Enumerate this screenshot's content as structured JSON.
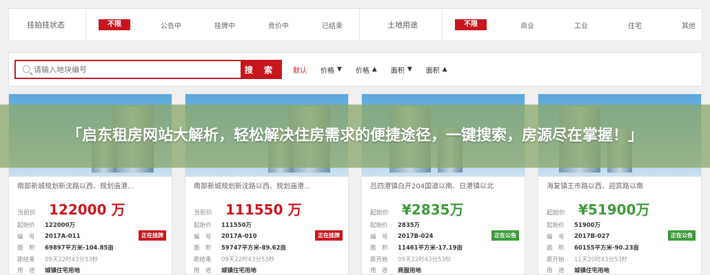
{
  "filters": {
    "status": {
      "label": "挂拍挂状态",
      "options": [
        "不限",
        "公告中",
        "挂牌中",
        "竞价中",
        "已结束"
      ]
    },
    "landuse": {
      "label": "土地用途",
      "options": [
        "不限",
        "商业",
        "工业",
        "住宅",
        "其他"
      ]
    }
  },
  "search": {
    "placeholder": "请输入地块编号",
    "button_label": "搜 索"
  },
  "sort": [
    {
      "label": "默认",
      "arrow": ""
    },
    {
      "label": "价格",
      "arrow": "▼"
    },
    {
      "label": "价格",
      "arrow": "▲"
    },
    {
      "label": "面积",
      "arrow": "▼"
    },
    {
      "label": "面积",
      "arrow": "▲"
    }
  ],
  "overlay": {
    "text": "「启东租房网站大解析，轻松解决住房需求的便捷途径，一键搜索，房源尽在掌握！」"
  },
  "cards": [
    {
      "title": "南部新城规划新沈路以西、规划庙港...",
      "price_label": "当前价",
      "price": "122000 万",
      "start_label": "起始价",
      "start_value": "122000万",
      "code_label": "编　号",
      "code_value": "2017A-011",
      "area_label": "面　积",
      "area_value": "69897平方米-104.85亩",
      "time_label": "距结束",
      "time_value": "09天22时43分53秒",
      "use_label": "用　途",
      "use_value": "城镇住宅用地",
      "badge": "正在挂牌"
    },
    {
      "title": "南部新城规划新沈路以西、规划庙港...",
      "price_label": "当前价",
      "price": "111550 万",
      "start_label": "起始价",
      "start_value": "111550万",
      "code_label": "编　号",
      "code_value": "2017A-010",
      "area_label": "面　积",
      "area_value": "59747平方米-89.62亩",
      "time_label": "距结束",
      "time_value": "09天22时43分53秒",
      "use_label": "用　途",
      "use_value": "城镇住宅用地",
      "badge": "正在挂牌"
    },
    {
      "title": "吕四港镇白开204国道以南、日港镇以北",
      "price_label": "起始价",
      "price": "¥2835万",
      "start_label": "起始价",
      "start_value": "2835万",
      "code_label": "编　号",
      "code_value": "2017B-024",
      "area_label": "面　积",
      "area_value": "11461平方米-17.19亩",
      "time_label": "距开始",
      "time_value": "09天22时43分53秒",
      "use_label": "用　途",
      "use_value": "商服用地",
      "badge": "正在公告"
    },
    {
      "title": "海复镇王市路以西、迎宾路以南",
      "price_label": "起始价",
      "price": "¥51900万",
      "start_label": "起始价",
      "start_value": "51900万",
      "code_label": "编　号",
      "code_value": "2017B-027",
      "area_label": "面　积",
      "area_value": "60155平方米-90.23亩",
      "time_label": "距开始",
      "time_value": "11天20时43分53秒",
      "use_label": "用　途",
      "use_value": "城镇住宅用地",
      "badge": "正在公告"
    }
  ],
  "colors": {
    "brand_red": "#c8161d",
    "notice_green": "#3d9a3b",
    "overlay": "#8ca86e"
  }
}
